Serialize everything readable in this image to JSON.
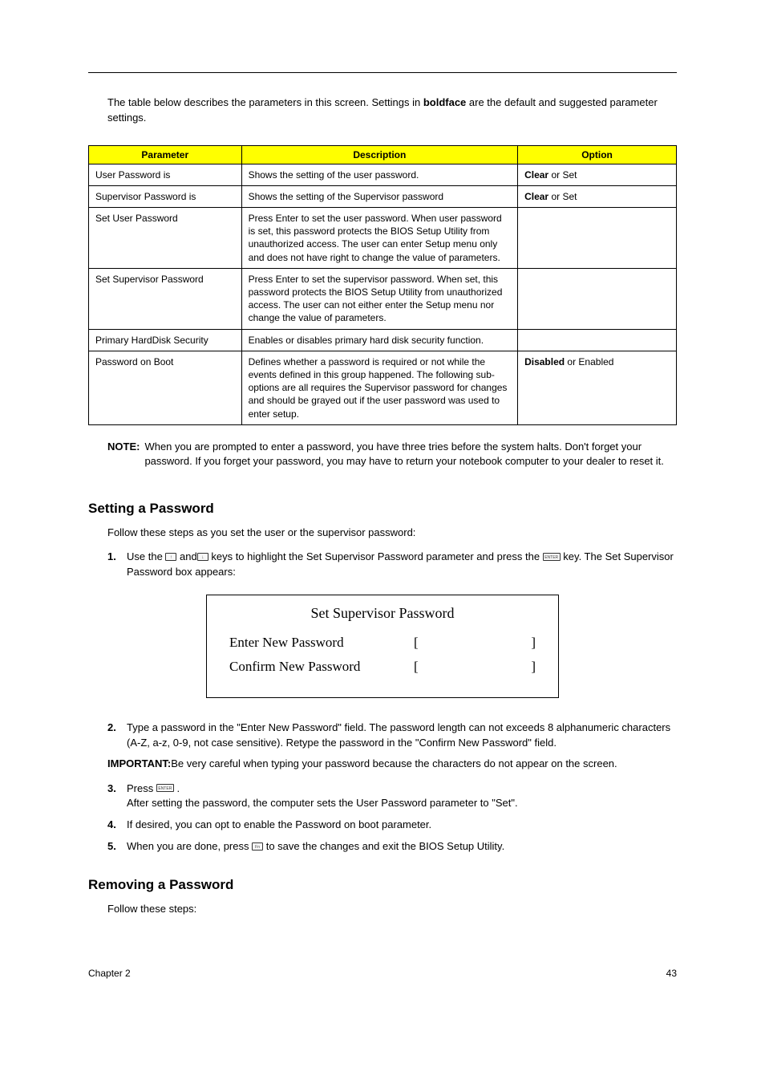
{
  "intro": {
    "pre": "The table below describes the parameters in this screen. Settings in ",
    "bold": "boldface",
    "post": " are the default and suggested parameter settings."
  },
  "table": {
    "headers": {
      "param": "Parameter",
      "desc": "Description",
      "opt": "Option"
    },
    "rows": [
      {
        "param": "User Password is",
        "desc": "Shows the setting of the user password.",
        "opt_bold": "Clear",
        "opt_rest": " or Set"
      },
      {
        "param": "Supervisor Password is",
        "desc": "Shows the setting of the Supervisor password",
        "opt_bold": "Clear",
        "opt_rest": " or Set"
      },
      {
        "param": "Set User Password",
        "desc": "Press Enter to set the user password. When user password is set, this password protects the BIOS Setup Utility from unauthorized access. The user can enter Setup menu only and does not have right to change the value of parameters.",
        "opt_bold": "",
        "opt_rest": ""
      },
      {
        "param": "Set Supervisor Password",
        "desc": "Press Enter to set the supervisor password. When set, this password protects the BIOS Setup Utility from unauthorized access. The user can not either enter the Setup menu nor change the value of parameters.",
        "opt_bold": "",
        "opt_rest": ""
      },
      {
        "param": "Primary HardDisk Security",
        "desc": "Enables or disables primary hard disk security function.",
        "opt_bold": "",
        "opt_rest": ""
      },
      {
        "param": "Password on Boot",
        "desc": "Defines whether a password is required or not while the events defined in this group happened. The following sub-options are all requires the Supervisor password for changes and should be grayed out if the user password was used to enter setup.",
        "opt_bold": "Disabled",
        "opt_rest": " or Enabled"
      }
    ]
  },
  "note": {
    "label": "NOTE:",
    "text": "When you are prompted to enter a password, you have three tries before the system halts. Don't forget your password. If you forget your password, you may have to return your notebook computer to your dealer to reset it."
  },
  "setting": {
    "heading": "Setting a Password",
    "intro": "Follow these steps as you set the user or the supervisor password:",
    "step1_a": "Use the ",
    "step1_b": " and",
    "step1_c": " keys to highlight the Set Supervisor Password parameter and press the ",
    "step1_d": " key. The Set Supervisor Password box appears:",
    "step2": "Type a password in the \"Enter New Password\" field. The password length can not exceeds 8 alphanumeric characters (A-Z, a-z, 0-9, not case sensitive). Retype the password in the \"Confirm New Password\" field.",
    "step3_a": "Press ",
    "step3_b": " .",
    "step3_after": "After setting the password, the computer sets the User Password parameter to \"Set\".",
    "step4": "If desired, you can opt to enable the Password on boot parameter.",
    "step5_a": "When you are done, press ",
    "step5_b": " to save the changes and exit the BIOS Setup Utility."
  },
  "dialog": {
    "title": "Set Supervisor Password",
    "row1": "Enter New Password",
    "row2": "Confirm New Password",
    "lbrace": "[",
    "rbrace": "]"
  },
  "important": {
    "label": "IMPORTANT:",
    "text": "Be very careful when typing your password because the characters do not appear on the screen."
  },
  "removing": {
    "heading": "Removing a Password",
    "intro": "Follow these steps:"
  },
  "footer": {
    "left": "Chapter 2",
    "right": "43"
  },
  "numbers": {
    "n1": "1.",
    "n2": "2.",
    "n3": "3.",
    "n4": "4.",
    "n5": "5."
  }
}
